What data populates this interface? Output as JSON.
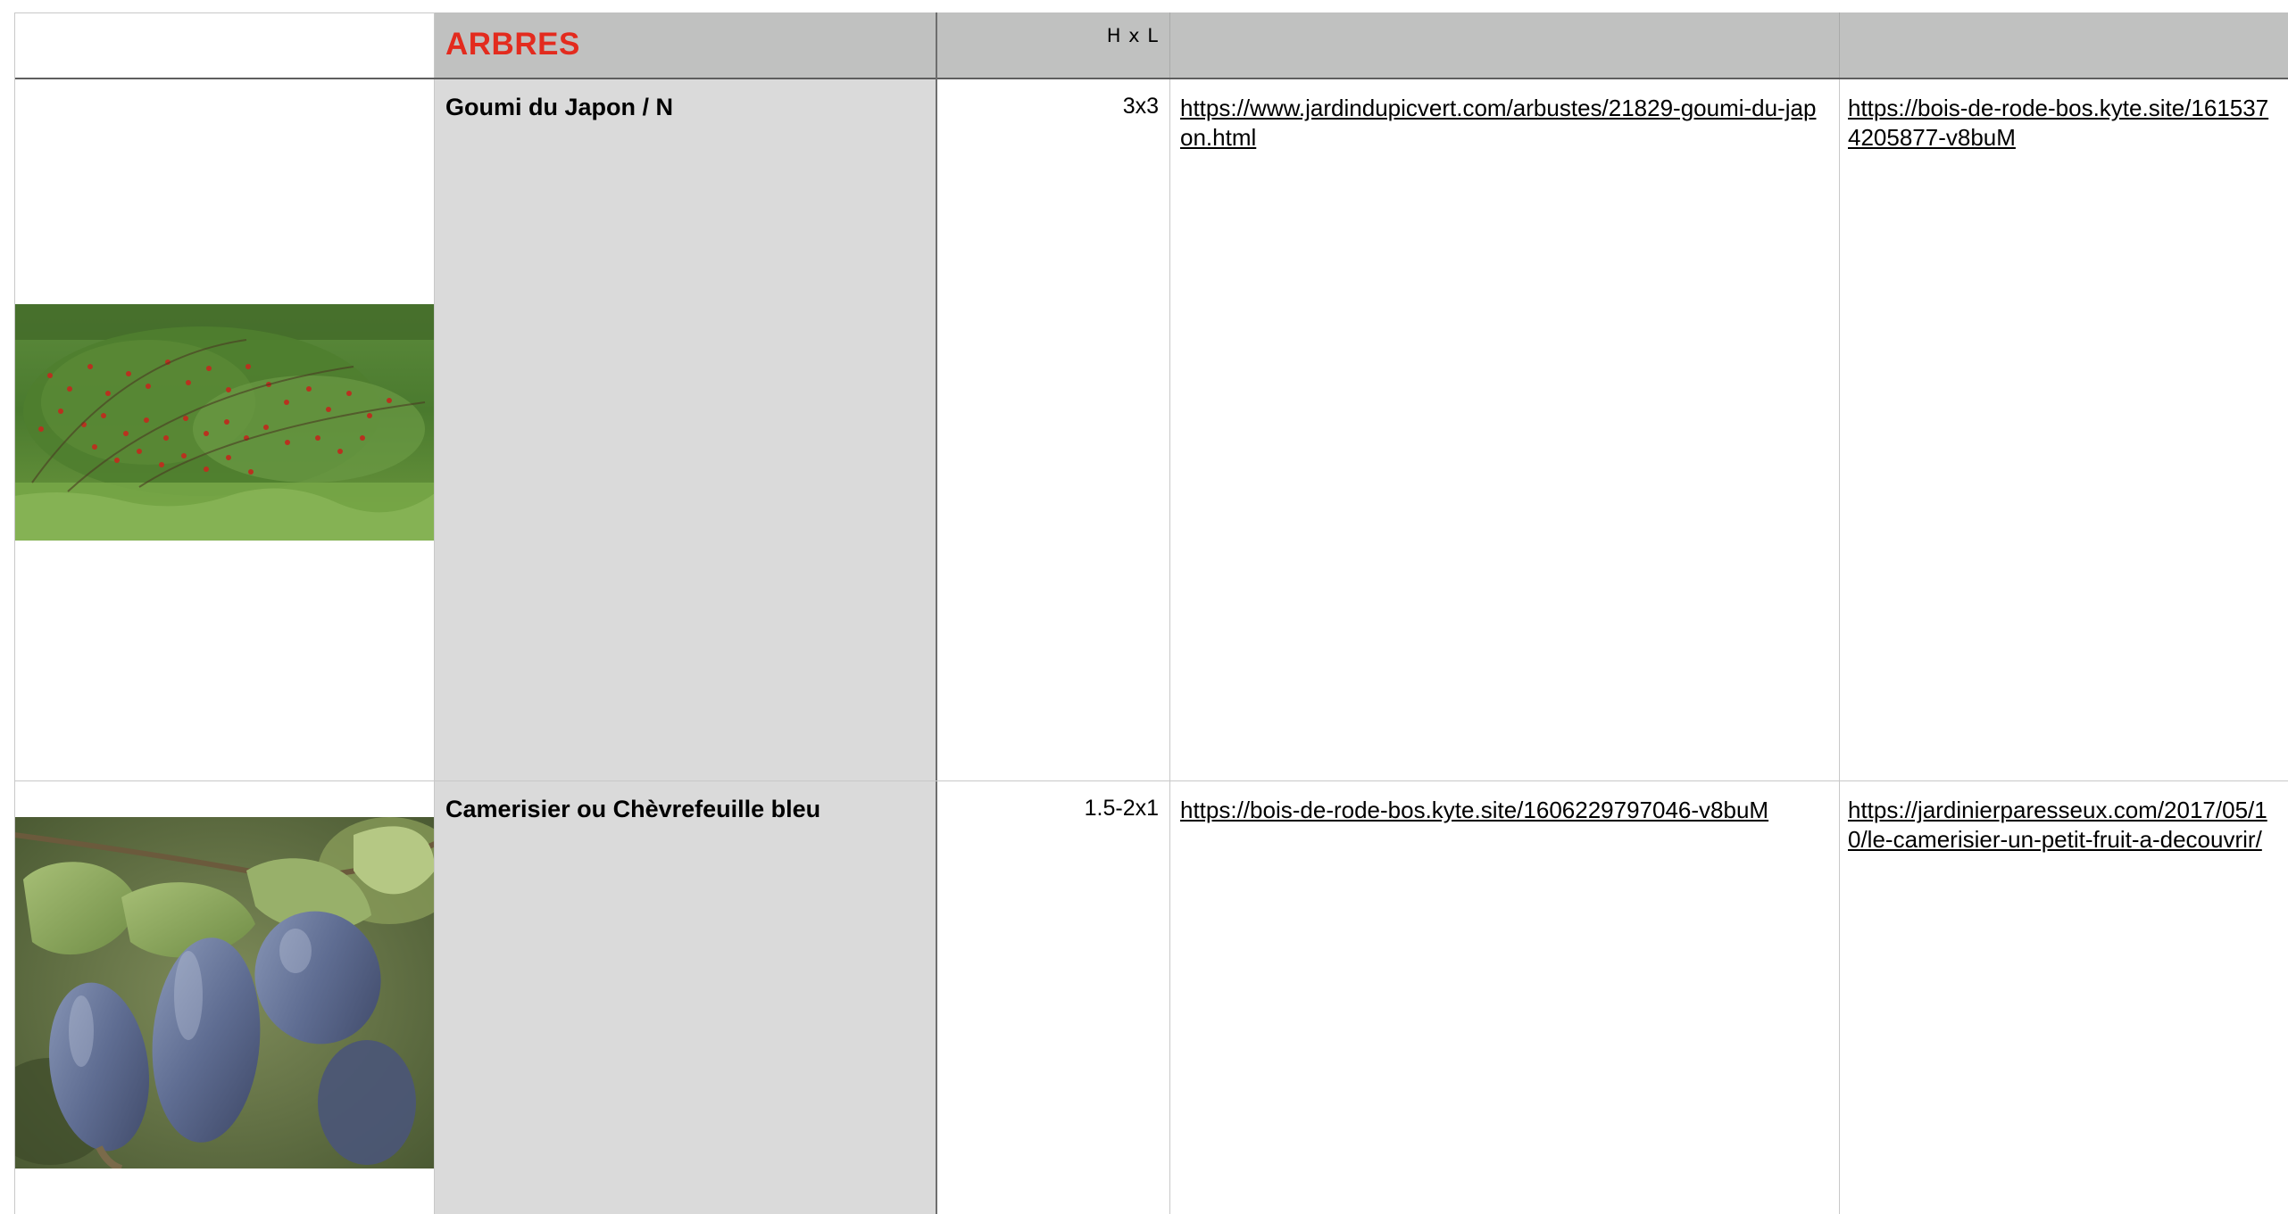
{
  "header": {
    "section_title": "ARBRES",
    "size_label": "H x L"
  },
  "rows": [
    {
      "name": "Goumi du Japon / N",
      "size": "3x3",
      "link1": "https://www.jardindupicvert.com/arbustes/21829-goumi-du-japon.html",
      "link2": "https://bois-de-rode-bos.kyte.site/1615374205877-v8buM",
      "photo": "goumi-shrub-photo"
    },
    {
      "name": "Camerisier ou Chèvrefeuille bleu",
      "size": "1.5-2x1",
      "link1": "https://bois-de-rode-bos.kyte.site/1606229797046-v8buM",
      "link2": "https://jardinierparesseux.com/2017/05/10/le-camerisier-un-petit-fruit-a-decouvrir/",
      "photo": "honeyberry-photo"
    }
  ],
  "colors": {
    "header_bg": "#c0c1c0",
    "name_column_bg": "#dadada",
    "section_title": "#e32b1e"
  }
}
